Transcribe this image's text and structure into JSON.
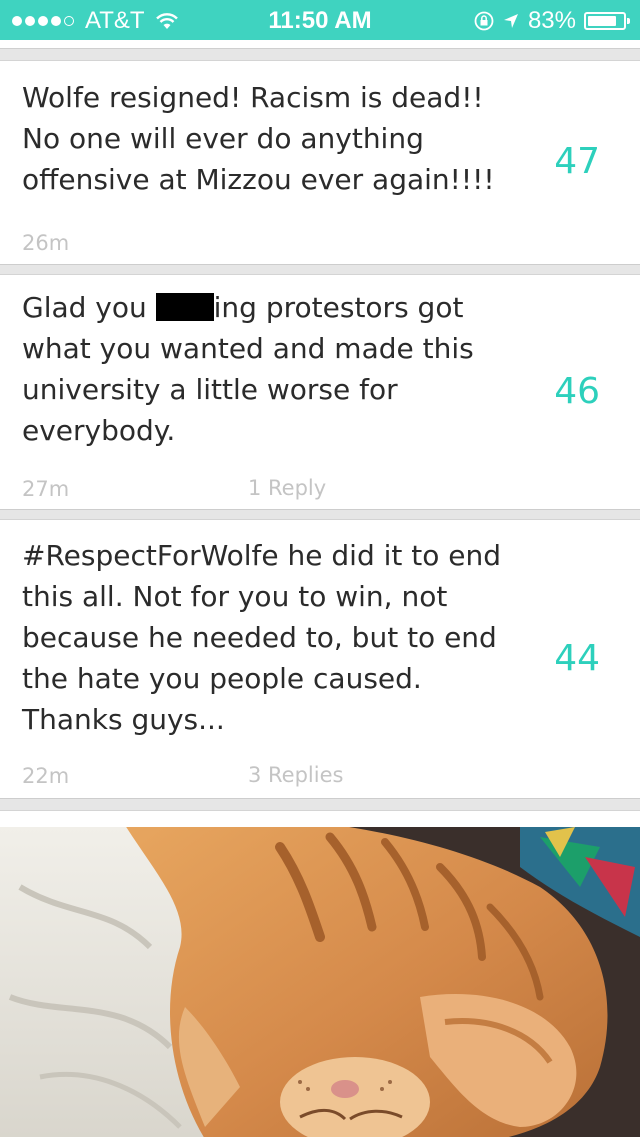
{
  "status_bar": {
    "carrier": "AT&T",
    "time": "11:50 AM",
    "battery_percent": "83%",
    "battery_level": 0.83,
    "signal_bars_filled": 4,
    "signal_bars_total": 5
  },
  "colors": {
    "accent": "#3fd3c0",
    "vote_color": "#2dd0bc",
    "meta_text": "#c4c4c4",
    "body_text": "#2b2b2b"
  },
  "posts": [
    {
      "lines": [
        "Wolfe resigned! Racism is dead!!",
        "No one will ever do anything",
        "offensive at Mizzou ever again!!!!"
      ],
      "votes": "47",
      "time": "26m",
      "replies": ""
    },
    {
      "line1_before": "Glad you ",
      "line1_after": "ing protestors got",
      "lines_rest": [
        "what you wanted and made this",
        "university a little worse for",
        "everybody."
      ],
      "votes": "46",
      "time": "27m",
      "replies": "1 Reply"
    },
    {
      "lines": [
        "#RespectForWolfe he did it to end",
        "this all. Not for you to win, not",
        "because he needed to, but to end",
        "the hate you people caused.",
        "Thanks guys..."
      ],
      "votes": "44",
      "time": "22m",
      "replies": "3 Replies"
    }
  ],
  "photo_post": {
    "image": "sleeping-orange-tabby-cat-photo"
  }
}
